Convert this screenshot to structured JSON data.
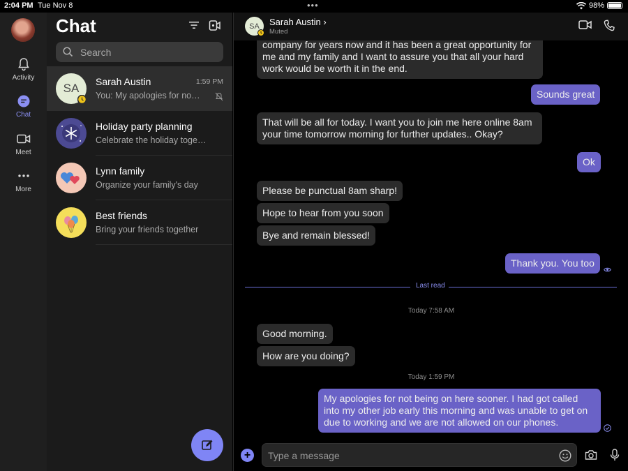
{
  "status_bar": {
    "time": "2:04 PM",
    "date": "Tue Nov 8",
    "battery": "98%",
    "battery_level": 0.98
  },
  "rail": {
    "items": [
      {
        "label": "Activity",
        "icon": "bell-icon"
      },
      {
        "label": "Chat",
        "icon": "chat-icon"
      },
      {
        "label": "Meet",
        "icon": "video-icon"
      },
      {
        "label": "More",
        "icon": "more-icon"
      }
    ]
  },
  "chat_list": {
    "title": "Chat",
    "search_placeholder": "Search",
    "conversations": [
      {
        "initials": "SA",
        "name": "Sarah Austin",
        "preview": "You: My apologies for not being on here sooner",
        "time": "1:59 PM"
      },
      {
        "name": "Holiday party planning",
        "preview": "Celebrate the holiday together"
      },
      {
        "name": "Lynn family",
        "preview": "Organize your family's day"
      },
      {
        "name": "Best friends",
        "preview": "Bring your friends together"
      }
    ]
  },
  "chat": {
    "contact_initials": "SA",
    "contact_name": "Sarah Austin",
    "contact_status": "Muted",
    "messages": [
      {
        "dir": "in",
        "lines": [
          "company for years now and it has been a great opportunity for",
          "me and my family and I want to assure you that all your hard",
          "work would be worth it in the end."
        ]
      },
      {
        "dir": "out",
        "text": "Sounds great"
      },
      {
        "dir": "in",
        "lines": [
          "That will be all for today. I want you to join me here online 8am",
          "your time tomorrow morning for further updates.. Okay?"
        ]
      },
      {
        "dir": "out",
        "text": "Ok"
      },
      {
        "dir": "in",
        "text": "Please be punctual 8am sharp!"
      },
      {
        "dir": "in",
        "text": "Hope to hear from you soon"
      },
      {
        "dir": "in",
        "text": "Bye and remain blessed!"
      },
      {
        "dir": "out",
        "text": "Thank you. You too"
      },
      {
        "dir": "in",
        "text": "Good morning."
      },
      {
        "dir": "in",
        "text": "How are you doing?"
      },
      {
        "dir": "out",
        "lines": [
          "My apologies for not being on here sooner. I had got called",
          "into my other job early this morning and was unable to get on",
          "due to working and we are not allowed on our phones."
        ]
      }
    ],
    "last_read_label": "Last read",
    "timestamps": [
      "Today 7:58 AM",
      "Today 1:59 PM"
    ],
    "composer_placeholder": "Type a message"
  },
  "colors": {
    "accent": "#7f85f5",
    "outgoing_bubble": "#6a62c7",
    "incoming_bubble": "#2b2b2b"
  }
}
